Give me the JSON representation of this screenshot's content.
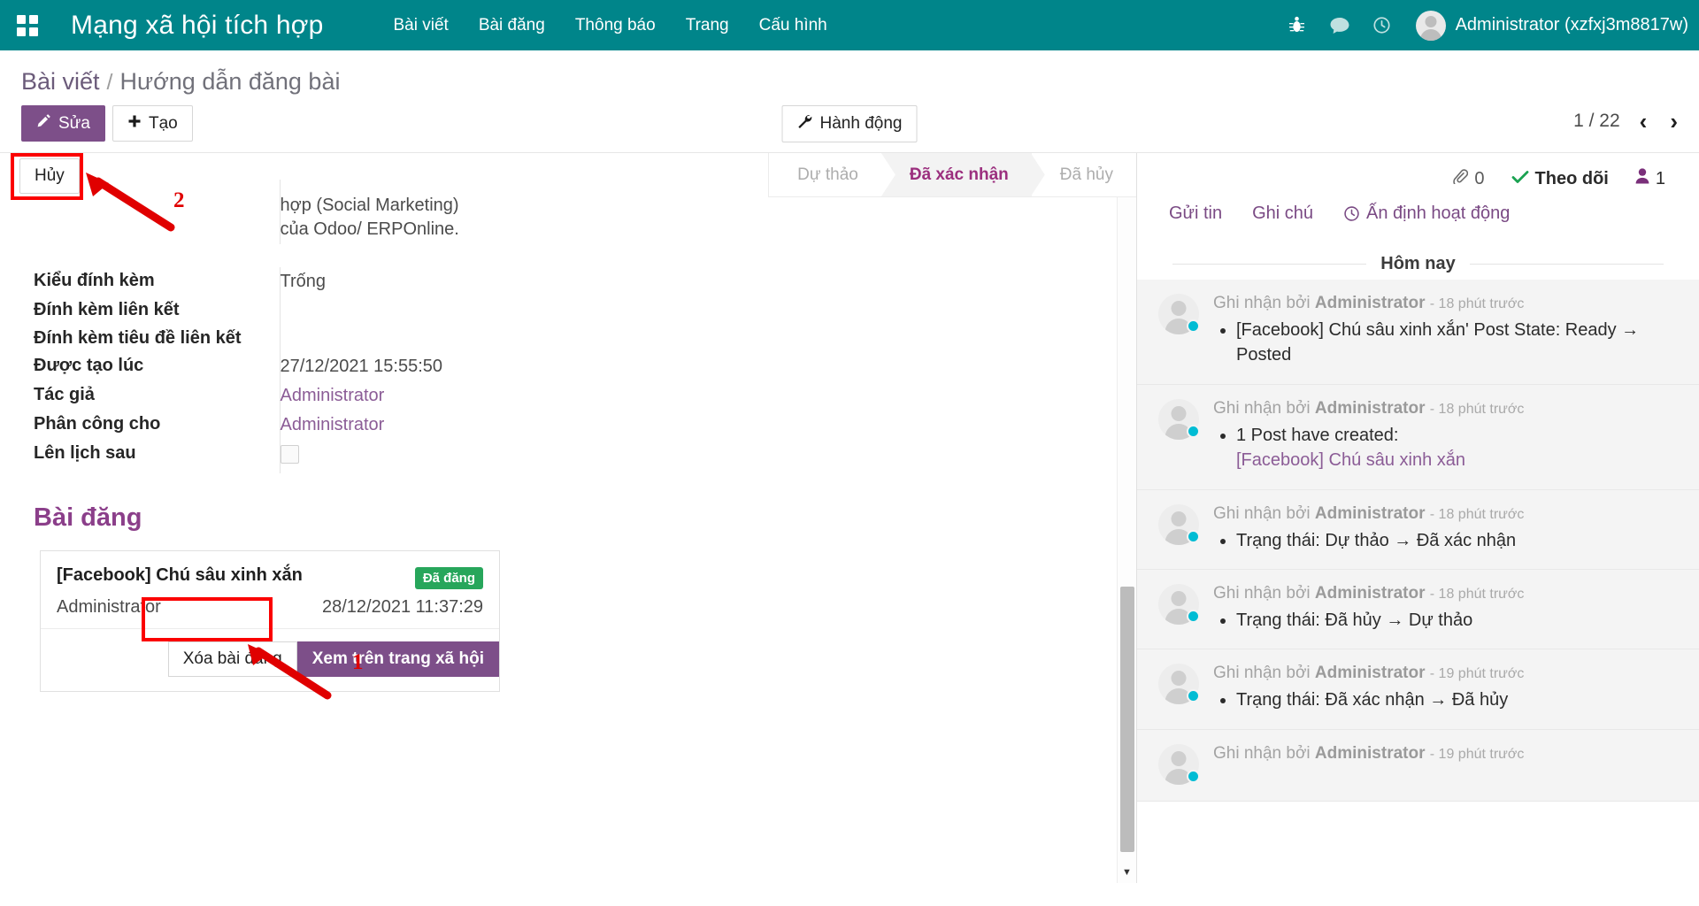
{
  "navbar": {
    "apps_icon": "apps-grid-icon",
    "brand": "Mạng xã hội tích hợp",
    "items": [
      {
        "label": "Bài viết"
      },
      {
        "label": "Bài đăng"
      },
      {
        "label": "Thông báo"
      },
      {
        "label": "Trang"
      },
      {
        "label": "Cấu hình"
      }
    ],
    "icons": [
      {
        "name": "bug-icon",
        "glyph": "☸"
      },
      {
        "name": "messages-icon",
        "glyph": "💬"
      },
      {
        "name": "activity-clock-icon",
        "glyph": "◷"
      }
    ],
    "user": "Administrator (xzfxj3m8817w)",
    "accent": "#00858a"
  },
  "breadcrumb": {
    "root": "Bài viết",
    "separator": "/",
    "current": "Hướng dẫn đăng bài"
  },
  "control_panel": {
    "edit_label": "Sửa",
    "edit_icon": "pencil-icon",
    "create_label": "Tạo",
    "create_icon": "plus-icon",
    "action_label": "Hành động",
    "action_icon": "wrench-icon",
    "discard_label": "Hủy",
    "pager_text": "1 / 22",
    "prev_glyph": "‹",
    "next_glyph": "›"
  },
  "statusbar": {
    "items": [
      {
        "label": "Dự thảo",
        "active": false
      },
      {
        "label": "Đã xác nhận",
        "active": true
      },
      {
        "label": "Đã hủy",
        "active": false
      }
    ],
    "active_color": "#9b2f7e"
  },
  "form": {
    "clipped_text_line1": "hợp (Social Marketing)",
    "clipped_text_line2": "của Odoo/ ERPOnline.",
    "fields": [
      {
        "label": "Kiểu đính kèm",
        "value": "Trống",
        "type": "text"
      },
      {
        "label": "Đính kèm liên kết",
        "value": "",
        "type": "text"
      },
      {
        "label": "Đính kèm tiêu đề liên kết",
        "value": "",
        "type": "text"
      },
      {
        "label": "Được tạo lúc",
        "value": "27/12/2021 15:55:50",
        "type": "text"
      },
      {
        "label": "Tác giả",
        "value": "Administrator",
        "type": "link"
      },
      {
        "label": "Phân công cho",
        "value": "Administrator",
        "type": "link"
      },
      {
        "label": "Lên lịch sau",
        "value": "",
        "type": "checkbox"
      }
    ],
    "section_title": "Bài đăng",
    "post_card": {
      "title": "[Facebook] Chú sâu xinh xắn",
      "badge": "Đã đăng",
      "badge_color": "#27a65b",
      "author": "Administrator",
      "datetime": "28/12/2021 11:37:29",
      "delete_label": "Xóa bài đăng",
      "view_label": "Xem trên trang xã hội"
    }
  },
  "annotations": [
    {
      "number": "1"
    },
    {
      "number": "2"
    }
  ],
  "chatter": {
    "attachments_count": "0",
    "attachment_icon": "paperclip-icon",
    "follow_label": "Theo dõi",
    "follow_icon": "check-icon",
    "followers_count": "1",
    "followers_icon": "user-icon",
    "tools": [
      {
        "label": "Gửi tin",
        "icon": ""
      },
      {
        "label": "Ghi chú",
        "icon": ""
      },
      {
        "label": "Ấn định hoạt động",
        "icon": "clock-icon"
      }
    ],
    "day_separator": "Hôm nay",
    "messages": [
      {
        "author_prefix": "Ghi nhận bởi",
        "author": "Administrator",
        "ago": "- 18 phút trước",
        "lines": [
          "[Facebook] Chú sâu xinh xắn' Post State: Ready → Posted"
        ],
        "link_line": ""
      },
      {
        "author_prefix": "Ghi nhận bởi",
        "author": "Administrator",
        "ago": "- 18 phút trước",
        "lines": [
          "1 Post have created:"
        ],
        "link_line": "[Facebook] Chú sâu xinh xắn"
      },
      {
        "author_prefix": "Ghi nhận bởi",
        "author": "Administrator",
        "ago": "- 18 phút trước",
        "lines": [
          "Trạng thái: Dự thảo → Đã xác nhận"
        ],
        "link_line": ""
      },
      {
        "author_prefix": "Ghi nhận bởi",
        "author": "Administrator",
        "ago": "- 18 phút trước",
        "lines": [
          "Trạng thái: Đã hủy → Dự thảo"
        ],
        "link_line": ""
      },
      {
        "author_prefix": "Ghi nhận bởi",
        "author": "Administrator",
        "ago": "- 19 phút trước",
        "lines": [
          "Trạng thái: Đã xác nhận → Đã hủy"
        ],
        "link_line": ""
      },
      {
        "author_prefix": "Ghi nhận bởi",
        "author": "Administrator",
        "ago": "- 19 phút trước",
        "lines": [
          ""
        ],
        "link_line": ""
      }
    ]
  }
}
